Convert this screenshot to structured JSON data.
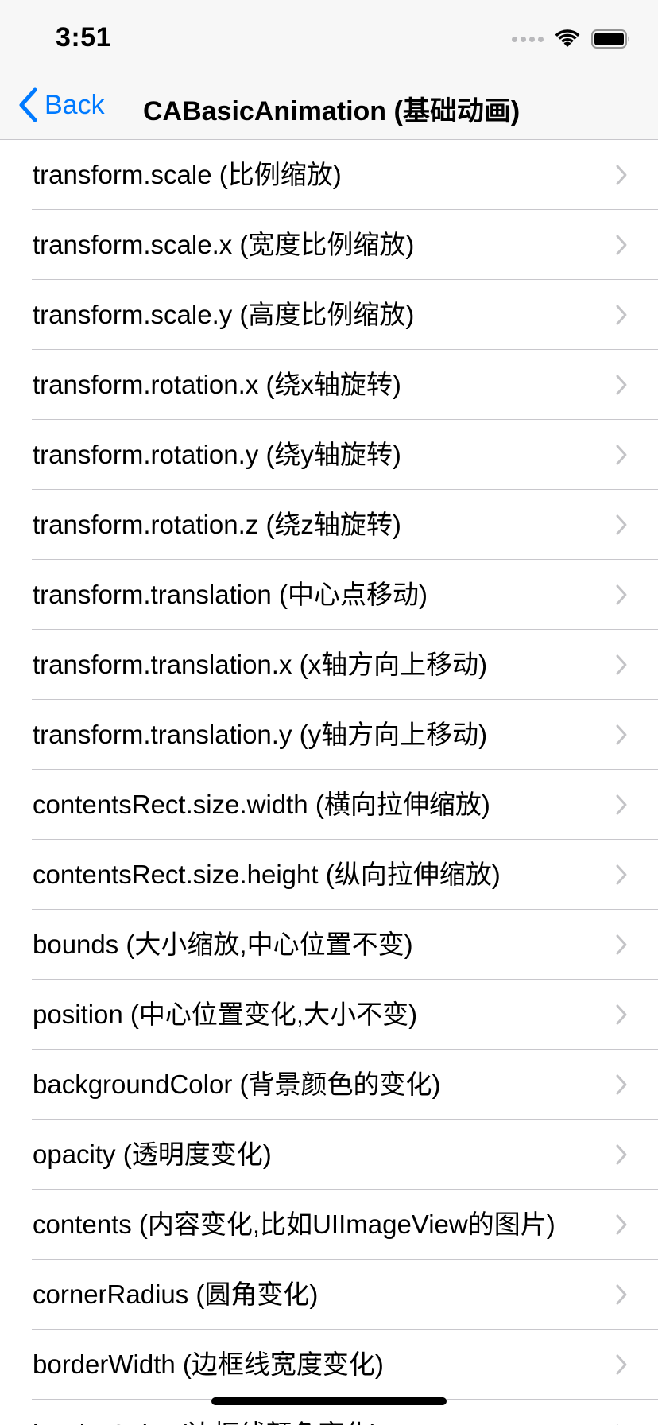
{
  "status_bar": {
    "time": "3:51",
    "icons": [
      "signal-dots-icon",
      "wifi-icon",
      "battery-icon"
    ]
  },
  "nav_bar": {
    "back_label": "Back",
    "title": "CABasicAnimation (基础动画)",
    "accent_color": "#007aff"
  },
  "list": {
    "items": [
      {
        "label": "transform.scale (比例缩放)"
      },
      {
        "label": "transform.scale.x (宽度比例缩放)"
      },
      {
        "label": "transform.scale.y (高度比例缩放)"
      },
      {
        "label": "transform.rotation.x (绕x轴旋转)"
      },
      {
        "label": "transform.rotation.y (绕y轴旋转)"
      },
      {
        "label": "transform.rotation.z (绕z轴旋转)"
      },
      {
        "label": "transform.translation (中心点移动)"
      },
      {
        "label": "transform.translation.x (x轴方向上移动)"
      },
      {
        "label": "transform.translation.y (y轴方向上移动)"
      },
      {
        "label": "contentsRect.size.width (横向拉伸缩放)"
      },
      {
        "label": "contentsRect.size.height (纵向拉伸缩放)"
      },
      {
        "label": "bounds (大小缩放,中心位置不变)"
      },
      {
        "label": "position (中心位置变化,大小不变)"
      },
      {
        "label": "backgroundColor (背景颜色的变化)"
      },
      {
        "label": "opacity (透明度变化)"
      },
      {
        "label": "contents (内容变化,比如UIImageView的图片)"
      },
      {
        "label": "cornerRadius (圆角变化)"
      },
      {
        "label": "borderWidth (边框线宽度变化)"
      },
      {
        "label": "borderColor (边框线颜色变化)"
      }
    ]
  }
}
